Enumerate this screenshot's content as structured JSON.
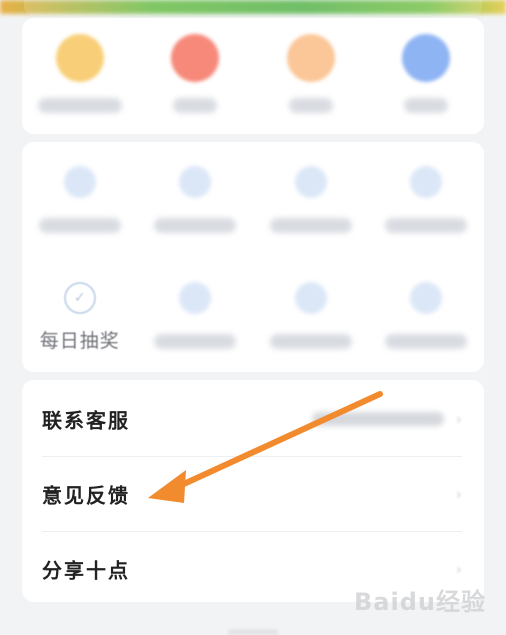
{
  "quick_row": {
    "items": [
      {
        "color": "#f8cf78"
      },
      {
        "color": "#f6897a"
      },
      {
        "color": "#fbc698"
      },
      {
        "color": "#8fb4f3"
      }
    ]
  },
  "tools_row1": {
    "items": [
      {},
      {},
      {},
      {}
    ]
  },
  "tools_row2": {
    "items": [
      {
        "label": "每日抽奖"
      },
      {},
      {},
      {}
    ]
  },
  "menu": {
    "items": [
      {
        "label": "联系客服"
      },
      {
        "label": "意见反馈"
      },
      {
        "label": "分享十点"
      }
    ]
  },
  "watermark": "Baidu经验",
  "colors": {
    "arrow": "#f28a2e"
  }
}
